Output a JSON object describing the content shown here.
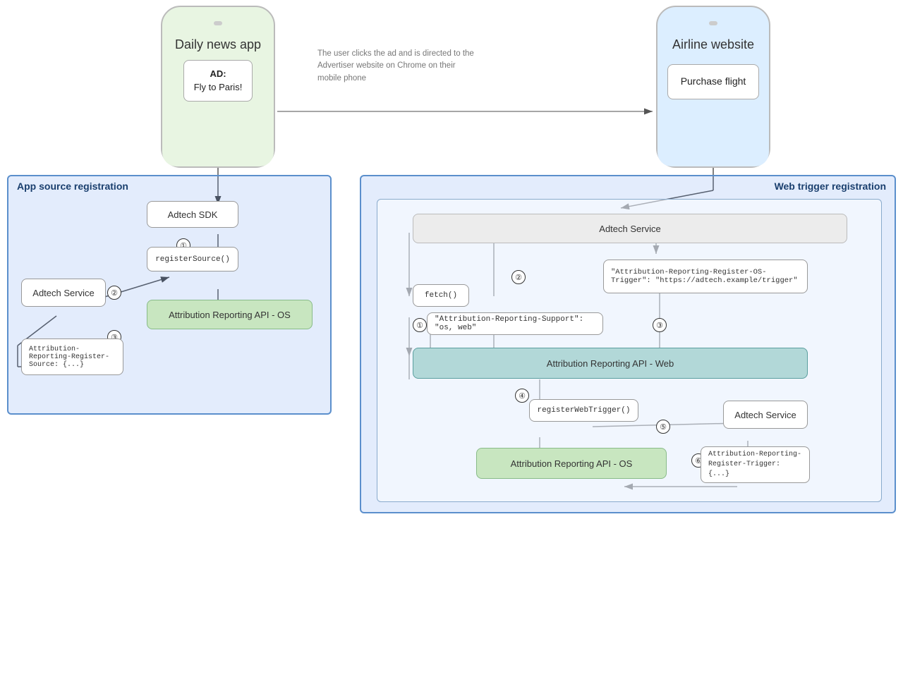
{
  "phones": {
    "news": {
      "title": "Daily news app",
      "ad_label": "AD:\nFly to Paris!"
    },
    "airline": {
      "title": "Airline website",
      "purchase_label": "Purchase flight"
    }
  },
  "description": "The user clicks the ad and is directed to the Advertiser website on Chrome on their mobile phone",
  "left_box": {
    "title": "App source registration",
    "nodes": {
      "adtech_sdk": "Adtech SDK",
      "adtech_service": "Adtech Service",
      "register_source": "registerSource()",
      "attribution_os": "Attribution Reporting API - OS",
      "attribution_register_source": "Attribution-Reporting-Register-Source: {...}"
    }
  },
  "right_box": {
    "title": "Web trigger registration",
    "nodes": {
      "adtech_service_top": "Adtech Service",
      "fetch": "fetch()",
      "attribution_web": "Attribution Reporting API - Web",
      "register_web_trigger": "registerWebTrigger()",
      "adtech_service_right": "Adtech Service",
      "attribution_os": "Attribution Reporting API - OS",
      "attribution_support": "\"Attribution-Reporting-Support\": \"os, web\"",
      "attribution_os_trigger": "\"Attribution-Reporting-Register-OS-Trigger\":\n\"https://adtech.example/trigger\"",
      "attribution_register_trigger": "Attribution-Reporting-\nRegister-Trigger: {...}"
    }
  }
}
